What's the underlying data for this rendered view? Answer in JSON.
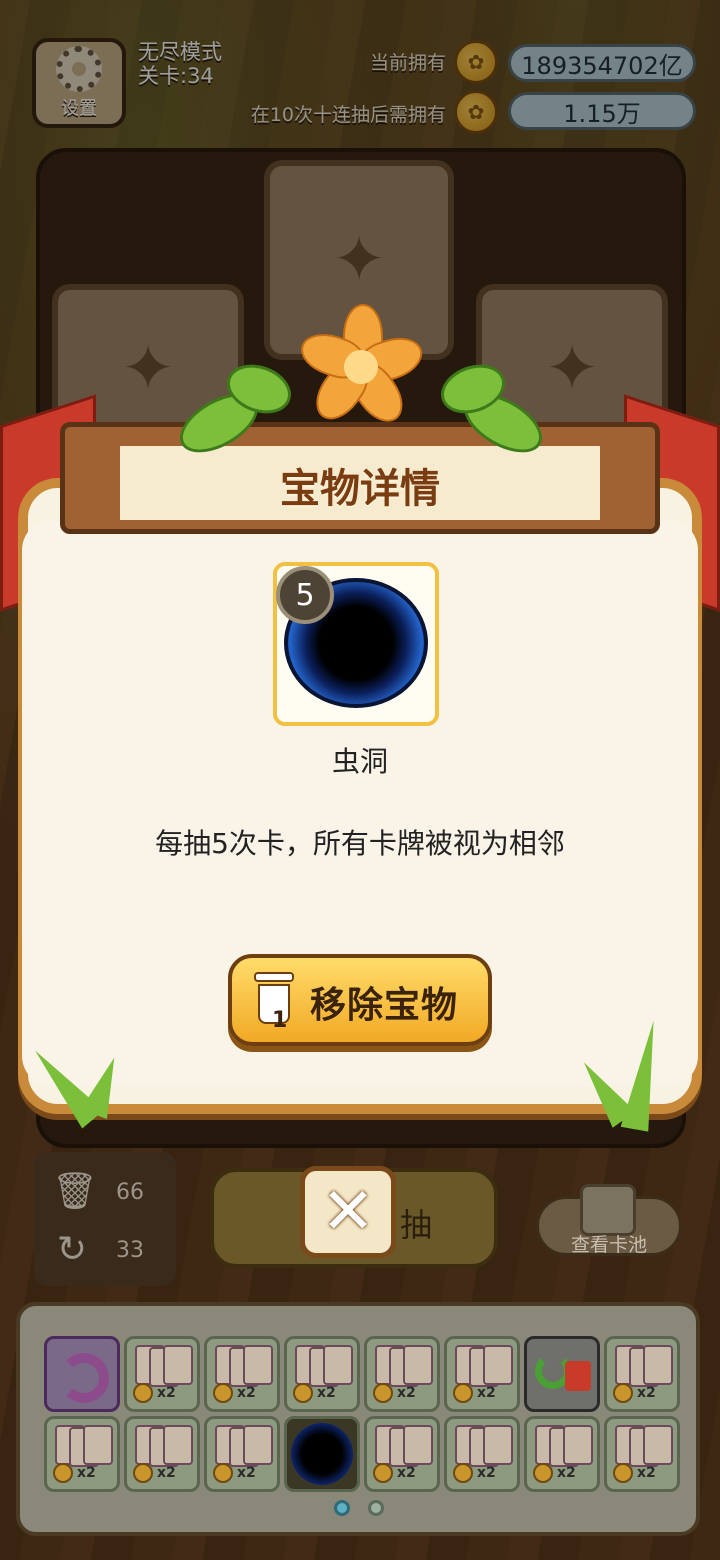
{
  "header": {
    "settings_label": "设置",
    "mode": "无尽模式",
    "level": "关卡:34",
    "owned_label": "当前拥有",
    "owned_value": "189354702亿",
    "required_label": "在10次十连抽后需拥有",
    "required_value": "1.15万"
  },
  "modal": {
    "title": "宝物详情",
    "item_level": "5",
    "item_name": "虫洞",
    "description": "每抽5次卡，所有卡牌被视为相邻",
    "remove_label": "移除宝物",
    "remove_count": "1"
  },
  "bottom": {
    "discard_count": "66",
    "refresh_count": "33",
    "draw_label": "抽",
    "view_pool_label": "查看卡池",
    "page_count": 2,
    "active_page": 1
  },
  "inventory": {
    "slot_icons": [
      "undo-icon",
      "card-pack-icon",
      "card-pack-icon",
      "card-pack-icon",
      "card-pack-icon",
      "card-pack-icon",
      "recycle-trash-icon",
      "card-pack-icon",
      "card-pack-icon",
      "card-pack-icon",
      "card-pack-icon",
      "wormhole-icon",
      "card-pack-icon",
      "card-pack-icon",
      "card-pack-icon",
      "card-pack-icon"
    ],
    "pack_multiplier": "x2"
  },
  "colors": {
    "accent_gold": "#f1a925",
    "ribbon_red": "#c93a2a",
    "panel_cream": "#f8f2e3"
  }
}
